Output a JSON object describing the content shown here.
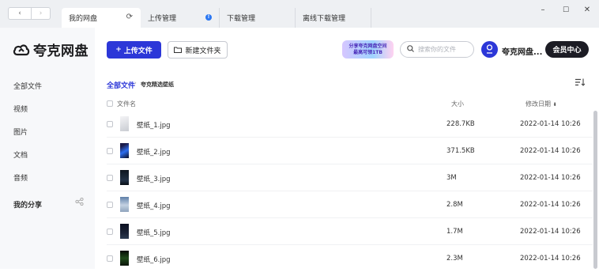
{
  "tabs": [
    {
      "label": "我的网盘",
      "icon": "refresh-icon"
    },
    {
      "label": "上传管理",
      "icon": "info-badge-icon"
    },
    {
      "label": "下载管理"
    },
    {
      "label": "离线下载管理"
    }
  ],
  "window": {
    "minimize": "–",
    "maximize": "☐",
    "close": "✕"
  },
  "logo": {
    "text": "夸克网盘"
  },
  "sidebar": {
    "items": [
      {
        "label": "全部文件"
      },
      {
        "label": "视频"
      },
      {
        "label": "图片"
      },
      {
        "label": "文档"
      },
      {
        "label": "音频"
      },
      {
        "label": "我的分享"
      }
    ]
  },
  "toolbar": {
    "upload_label": "上传文件",
    "new_folder_label": "新建文件夹",
    "promo_line1": "分享夸克网盘空间",
    "promo_line2": "最高可领1TB",
    "search_placeholder": "搜索你的文件",
    "username": "夸克网盘...",
    "vip_label": "会员中心"
  },
  "breadcrumb": {
    "root": "全部文件",
    "separator": "›",
    "current": "夸克精选壁纸"
  },
  "table": {
    "headers": {
      "name": "文件名",
      "size": "大小",
      "date": "修改日期",
      "sort_arrow": "⬇"
    },
    "rows": [
      {
        "name": "壁纸_1.jpg",
        "size": "228.7KB",
        "date": "2022-01-14 10:26"
      },
      {
        "name": "壁纸_2.jpg",
        "size": "371.5KB",
        "date": "2022-01-14 10:26"
      },
      {
        "name": "壁纸_3.jpg",
        "size": "3M",
        "date": "2022-01-14 10:26"
      },
      {
        "name": "壁纸_4.jpg",
        "size": "2.8M",
        "date": "2022-01-14 10:26"
      },
      {
        "name": "壁纸_5.jpg",
        "size": "1.7M",
        "date": "2022-01-14 10:26"
      },
      {
        "name": "壁纸_6.jpg",
        "size": "2.3M",
        "date": "2022-01-14 10:26"
      }
    ]
  },
  "colors": {
    "accent": "#2c37d8",
    "vip_bg": "#1c1c24",
    "sidebar_bg": "#f7f8fa",
    "tabbar_bg": "#eef0f3"
  }
}
